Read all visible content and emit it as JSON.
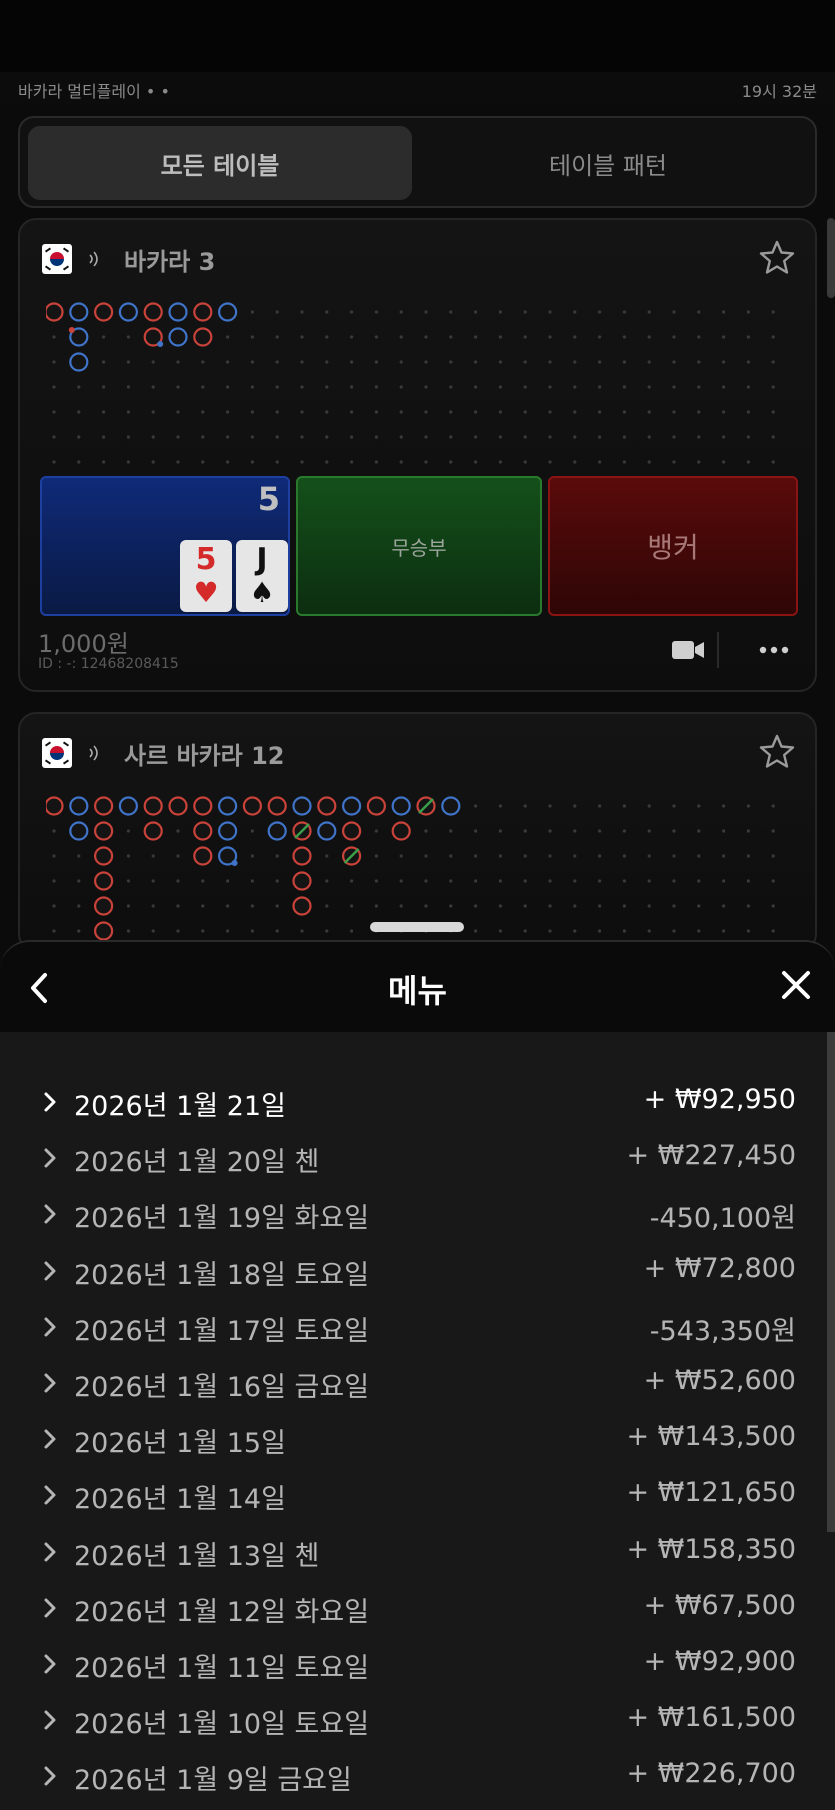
{
  "status": {
    "app_title": "바카라 멀티플레이 • •",
    "time": "19시 32분"
  },
  "tabs": [
    {
      "label": "모든 테이블",
      "active": true
    },
    {
      "label": "테이블 패턴",
      "active": false
    }
  ],
  "tables": [
    {
      "name": "바카라 3",
      "flag": "korea-flag",
      "player_label": "",
      "player_score": "5",
      "player_cards": [
        {
          "rank": "5",
          "suit": "♥",
          "color": "#d42a2a"
        },
        {
          "rank": "J",
          "suit": "♠",
          "color": "#111111"
        }
      ],
      "tie_label": "무승부",
      "banker_label": "뱅커",
      "bet_amount": "1,000원",
      "table_id": "ID : -: 12468208415"
    },
    {
      "name": "사르 바카라 12",
      "flag": "korea-flag"
    }
  ],
  "menu": {
    "title": "메뉴",
    "back_icon": "chevron-left-icon",
    "close_icon": "close-icon",
    "entries": [
      {
        "date": "2026년 1월 21일",
        "value": "+ ₩92,950"
      },
      {
        "date": "2026년 1월 20일 첸",
        "value": "+ ₩227,450"
      },
      {
        "date": "2026년 1월 19일 화요일",
        "value": "-450,100원"
      },
      {
        "date": "2026년 1월 18일 토요일",
        "value": "+ ₩72,800"
      },
      {
        "date": "2026년 1월 17일 토요일",
        "value": "-543,350원"
      },
      {
        "date": "2026년 1월 16일 금요일",
        "value": "+ ₩52,600"
      },
      {
        "date": "2026년 1월 15일",
        "value": "+ ₩143,500"
      },
      {
        "date": "2026년 1월 14일",
        "value": "+ ₩121,650"
      },
      {
        "date": "2026년 1월 13일 첸",
        "value": "+ ₩158,350"
      },
      {
        "date": "2026년 1월 12일 화요일",
        "value": "+ ₩67,500"
      },
      {
        "date": "2026년 1월 11일 토요일",
        "value": "+ ₩92,900"
      },
      {
        "date": "2026년 1월 10일 토요일",
        "value": "+ ₩161,500"
      },
      {
        "date": "2026년 1월 9일 금요일",
        "value": "+ ₩226,700"
      }
    ]
  },
  "colors": {
    "banker": "#c9433a",
    "player": "#3f74c9",
    "tie": "#3aa04a"
  }
}
